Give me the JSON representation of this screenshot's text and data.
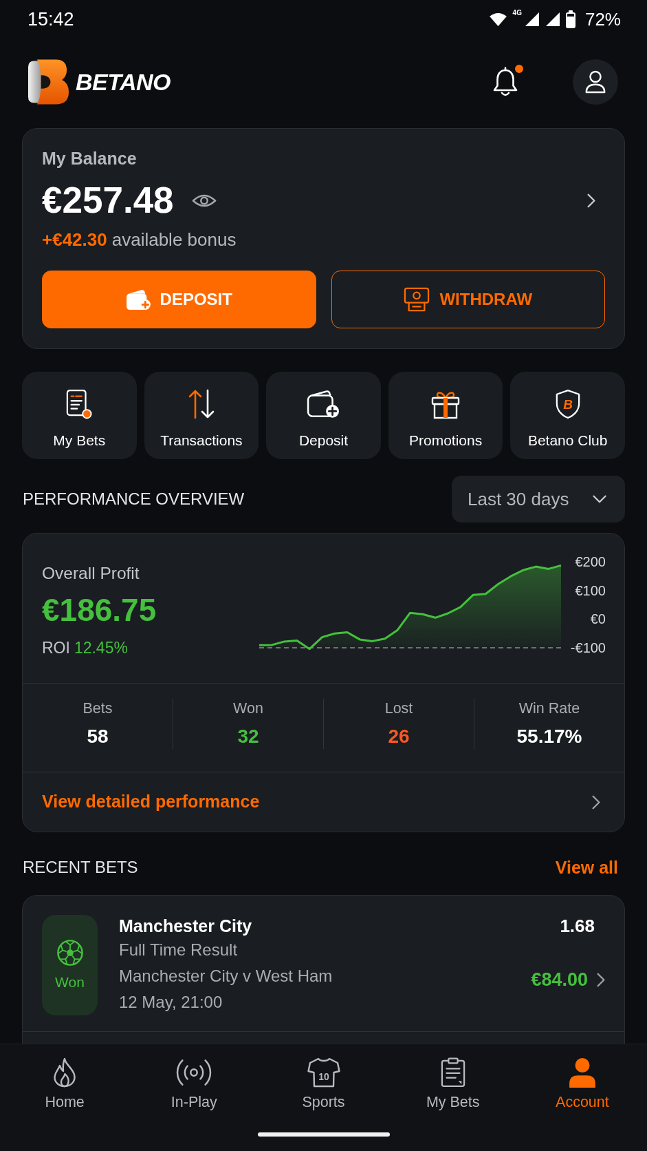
{
  "status_bar": {
    "time": "15:42",
    "network": "4G",
    "battery": "72%"
  },
  "header": {
    "brand": "BETANO",
    "unread": true
  },
  "balance": {
    "label": "My Balance",
    "amount": "€257.48",
    "bonus_amount": "+€42.30",
    "bonus_label": "available bonus",
    "buttons": [
      {
        "kind": "filled",
        "label": "DEPOSIT"
      },
      {
        "kind": "outline",
        "label": "WITHDRAW"
      }
    ]
  },
  "quick_actions": [
    {
      "label": "My Bets"
    },
    {
      "label": "Transactions"
    },
    {
      "label": "Deposit"
    },
    {
      "label": "Promotions"
    },
    {
      "label": "Betano Club",
      "emblem": "B"
    }
  ],
  "performance": {
    "title": "PERFORMANCE OVERVIEW",
    "period": "Last 30 days",
    "profit_label": "Overall Profit",
    "profit": "€186.75",
    "roi_label": "ROI",
    "roi": "12.45%",
    "chart_data": {
      "type": "line",
      "ylim": [
        -110,
        210
      ],
      "yticks": [
        {
          "value": 200,
          "label": "€200"
        },
        {
          "value": 100,
          "label": "€100"
        },
        {
          "value": 0,
          "label": "€0"
        },
        {
          "value": -100,
          "label": "-€100"
        }
      ],
      "values": [
        -91,
        -90,
        -78,
        -75,
        -104,
        -63,
        -50,
        -46,
        -71,
        -77,
        -68,
        -38,
        22,
        17,
        5,
        20,
        42,
        84,
        88,
        122,
        149,
        171,
        183,
        175,
        187
      ]
    },
    "stats": [
      {
        "label": "Bets",
        "value": "58",
        "color": "#ffffff"
      },
      {
        "label": "Won",
        "value": "32",
        "color": "#45c03e"
      },
      {
        "label": "Lost",
        "value": "26",
        "color": "#ff5722"
      },
      {
        "label": "Win Rate",
        "value": "55.17%",
        "color": "#ffffff"
      }
    ],
    "link": "View detailed performance"
  },
  "recent_bets": {
    "title": "RECENT BETS",
    "view_all": "View all",
    "items": [
      {
        "kind": "won",
        "status": "Won",
        "selection": "Manchester City",
        "market": "Full Time Result",
        "event": "Manchester City v West Ham",
        "date": "12 May, 21:00",
        "odds": "1.68",
        "payout": "€84.00"
      }
    ]
  },
  "bottom_nav": {
    "items": [
      {
        "label": "Home",
        "selected": false
      },
      {
        "label": "In-Play",
        "selected": false
      },
      {
        "label": "Sports",
        "selected": false,
        "jersey_number": "10"
      },
      {
        "label": "My Bets",
        "selected": false
      },
      {
        "label": "Account",
        "selected": true
      }
    ]
  }
}
